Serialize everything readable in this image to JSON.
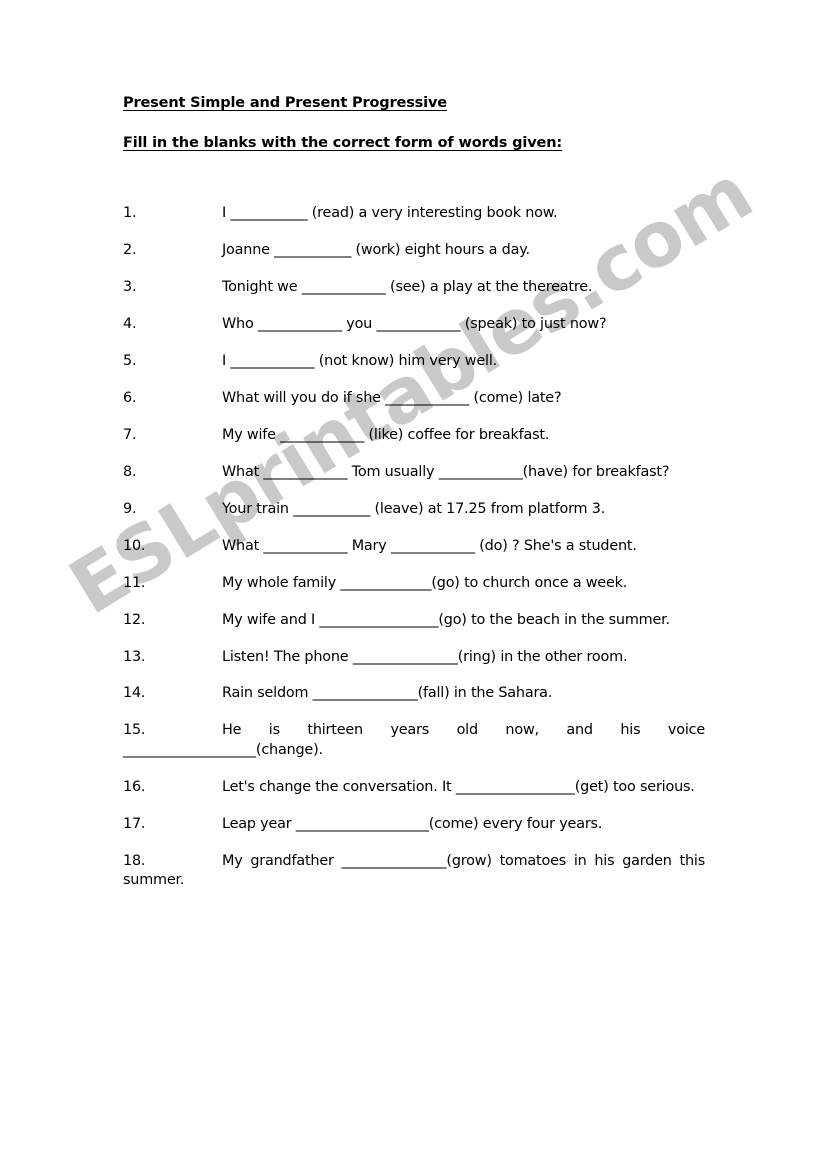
{
  "document": {
    "title": "Present Simple and Present Progressive",
    "subtitle": "Fill in the blanks with the correct form of words given:"
  },
  "watermark": {
    "text": "ESLprintables.com",
    "color": "#c9c9c9",
    "rotation_deg": -31.5
  },
  "exercise": {
    "items": [
      {
        "number": "1.",
        "text": "I  ___________ (read) a very interesting book now.",
        "justify": false
      },
      {
        "number": "2.",
        "text": "Joanne  ___________  (work) eight hours a day.",
        "justify": false
      },
      {
        "number": "3.",
        "text": "Tonight we ____________  (see) a play at the thereatre.",
        "justify": false
      },
      {
        "number": "4.",
        "text": "Who ____________  you ____________ (speak) to just now?",
        "justify": false
      },
      {
        "number": "5.",
        "text": "I  ____________  (not know) him very well.",
        "justify": false
      },
      {
        "number": "6.",
        "text": "What will you do if she ____________ (come) late?",
        "justify": false
      },
      {
        "number": "7.",
        "text": "My wife ____________  (like) coffee for breakfast.",
        "justify": false
      },
      {
        "number": "8.",
        "text": "What ____________ Tom usually ____________(have) for breakfast?",
        "justify": true
      },
      {
        "number": "9.",
        "text": "Your train ___________ (leave) at 17.25 from platform 3.",
        "justify": false
      },
      {
        "number": "10.",
        "text": "What ____________ Mary ____________ (do) ? She's a student.",
        "justify": true
      },
      {
        "number": "11.",
        "text": "My whole family _____________(go) to church once a week.",
        "justify": false
      },
      {
        "number": "12.",
        "text": "My wife and I _________________(go) to the beach in the summer.",
        "justify": true
      },
      {
        "number": "13.",
        "text": "Listen! The phone _______________(ring) in the other room.",
        "justify": false
      },
      {
        "number": "14.",
        "text": "Rain seldom _______________(fall) in the Sahara.",
        "justify": false
      },
      {
        "number": "15.",
        "text": "He is thirteen years old now, and his voice ___________________(change).",
        "justify": true
      },
      {
        "number": "16.",
        "text": "Let's change the conversation. It _________________(get) too serious.",
        "justify": true
      },
      {
        "number": "17.",
        "text": "Leap year ___________________(come) every four years.",
        "justify": false
      },
      {
        "number": "18.",
        "text": "My grandfather _______________(grow) tomatoes in his garden this summer.",
        "justify": true
      }
    ]
  }
}
